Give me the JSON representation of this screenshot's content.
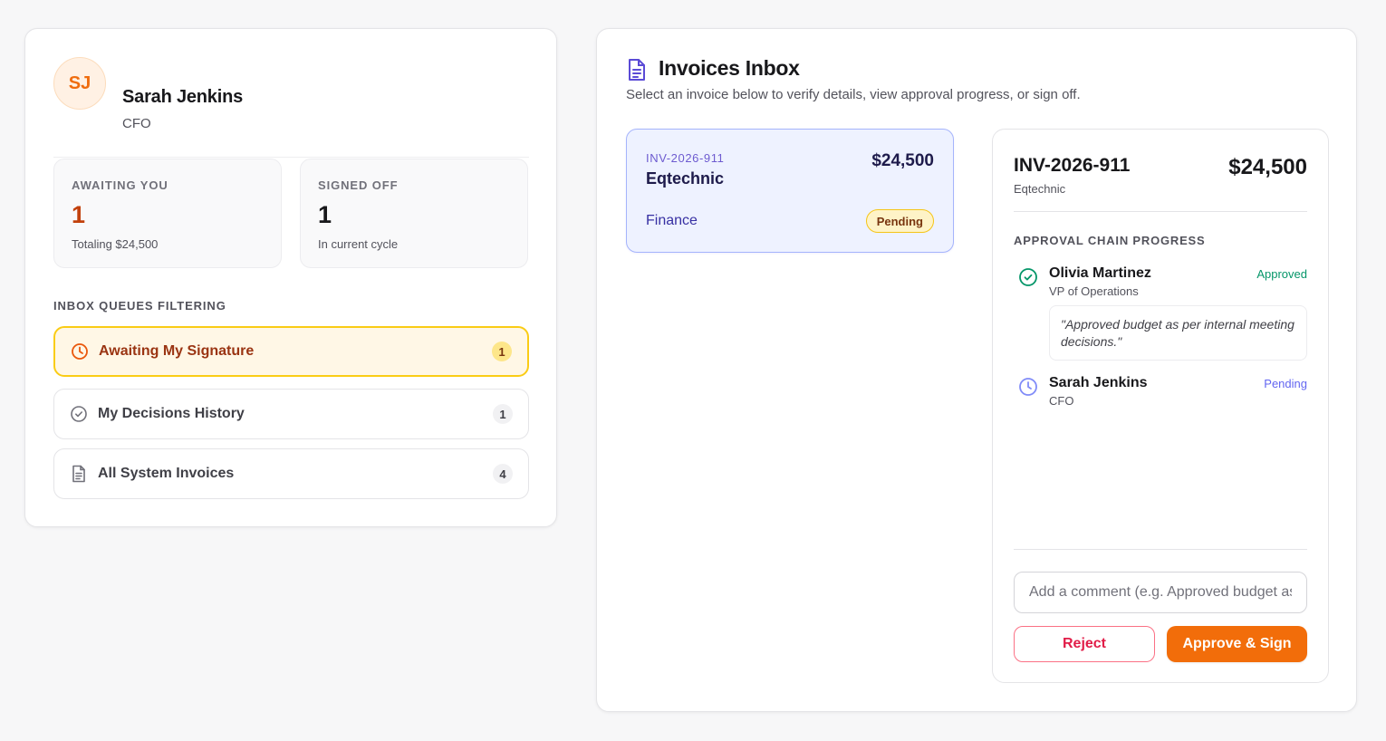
{
  "user": {
    "initials": "SJ",
    "name": "Sarah Jenkins",
    "role": "CFO"
  },
  "stats": {
    "awaiting": {
      "label": "AWAITING YOU",
      "value": "1",
      "sub": "Totaling $24,500"
    },
    "signed": {
      "label": "SIGNED OFF",
      "value": "1",
      "sub": "In current cycle"
    }
  },
  "queues": {
    "title": "INBOX QUEUES FILTERING",
    "items": [
      {
        "label": "Awaiting My Signature",
        "count": "1",
        "icon": "clock-icon",
        "active": true
      },
      {
        "label": "My Decisions History",
        "count": "1",
        "icon": "check-circle-icon",
        "active": false
      },
      {
        "label": "All System Invoices",
        "count": "4",
        "icon": "document-icon",
        "active": false
      }
    ]
  },
  "inbox": {
    "title": "Invoices Inbox",
    "subtitle": "Select an invoice below to verify details, view approval progress, or sign off."
  },
  "invoices": [
    {
      "id": "INV-2026-911",
      "vendor": "Eqtechnic",
      "amount": "$24,500",
      "department": "Finance",
      "status": "Pending"
    }
  ],
  "detail": {
    "id": "INV-2026-911",
    "vendor": "Eqtechnic",
    "amount": "$24,500",
    "chain_title": "APPROVAL CHAIN PROGRESS",
    "steps": [
      {
        "name": "Olivia Martinez",
        "role": "VP of Operations",
        "status": "Approved",
        "comment": "\"Approved budget as per internal meeting decisions.\""
      },
      {
        "name": "Sarah Jenkins",
        "role": "CFO",
        "status": "Pending"
      }
    ],
    "comment_placeholder": "Add a comment (e.g. Approved budget as per internal meeting decisions)",
    "reject_label": "Reject",
    "approve_label": "Approve & Sign"
  },
  "colors": {
    "accent": "#f26d0a",
    "approved": "#059669",
    "pending": "#6366f1",
    "selected_bg": "#eef2ff"
  }
}
